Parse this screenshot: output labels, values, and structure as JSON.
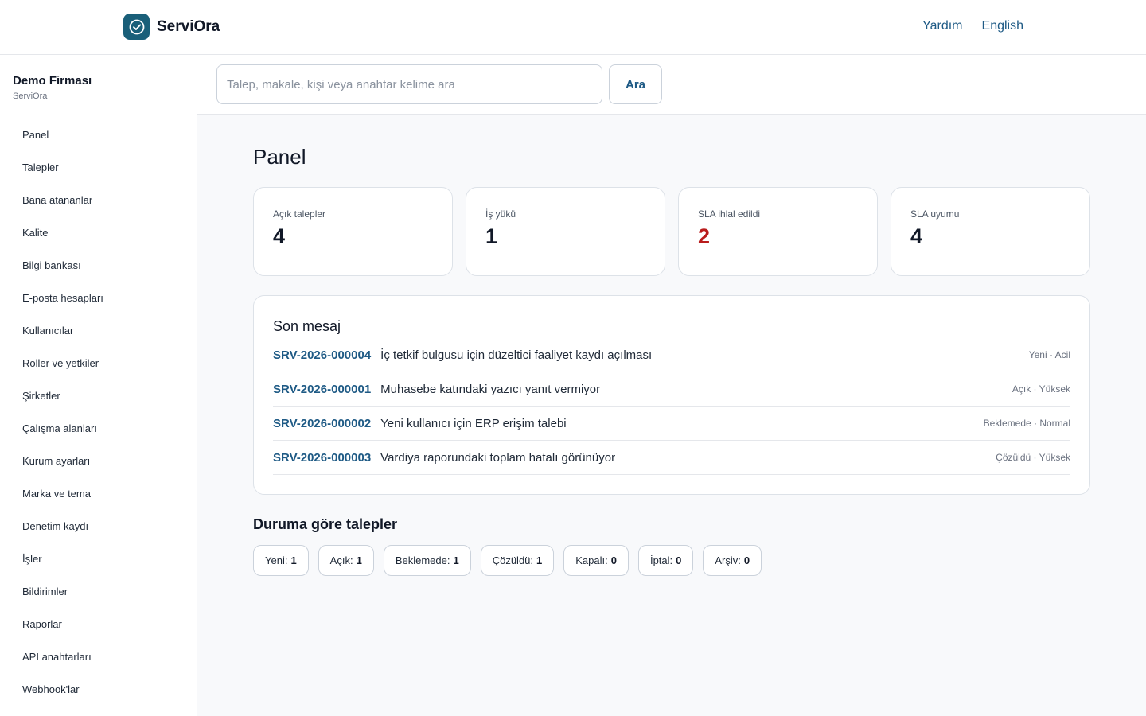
{
  "brand": {
    "name": "ServiOra"
  },
  "top_links": [
    {
      "label": "Yardım"
    },
    {
      "label": "English"
    }
  ],
  "org": {
    "name": "Demo Firması",
    "sub": "ServiOra"
  },
  "nav": [
    {
      "label": "Panel"
    },
    {
      "label": "Talepler"
    },
    {
      "label": "Bana atananlar"
    },
    {
      "label": "Kalite"
    },
    {
      "label": "Bilgi bankası"
    },
    {
      "label": "E-posta hesapları"
    },
    {
      "label": "Kullanıcılar"
    },
    {
      "label": "Roller ve yetkiler"
    },
    {
      "label": "Şirketler"
    },
    {
      "label": "Çalışma alanları"
    },
    {
      "label": "Kurum ayarları"
    },
    {
      "label": "Marka ve tema"
    },
    {
      "label": "Denetim kaydı"
    },
    {
      "label": "İşler"
    },
    {
      "label": "Bildirimler"
    },
    {
      "label": "Raporlar"
    },
    {
      "label": "API anahtarları"
    },
    {
      "label": "Webhook'lar"
    }
  ],
  "search": {
    "placeholder": "Talep, makale, kişi veya anahtar kelime ara",
    "value": "",
    "button": "Ara"
  },
  "page": {
    "title": "Panel"
  },
  "stats": [
    {
      "label": "Açık talepler",
      "value": "4"
    },
    {
      "label": "İş yükü",
      "value": "1"
    },
    {
      "label": "SLA ihlal edildi",
      "value": "2"
    },
    {
      "label": "SLA uyumu",
      "value": "4"
    }
  ],
  "messages": {
    "title": "Son mesaj",
    "rows": [
      {
        "code": "SRV-2026-000004",
        "subject": "İç tetkif bulgusu için düzeltici faaliyet kaydı açılması",
        "meta": "Yeni · Acil"
      },
      {
        "code": "SRV-2026-000001",
        "subject": "Muhasebe katındaki yazıcı yanıt vermiyor",
        "meta": "Açık · Yüksek"
      },
      {
        "code": "SRV-2026-000002",
        "subject": "Yeni kullanıcı için ERP erişim talebi",
        "meta": "Beklemede · Normal"
      },
      {
        "code": "SRV-2026-000003",
        "subject": "Vardiya raporundaki toplam hatalı görünüyor",
        "meta": "Çözüldü · Yüksek"
      }
    ]
  },
  "status": {
    "title": "Duruma göre talepler",
    "pills": [
      {
        "label": "Yeni:",
        "count": "1"
      },
      {
        "label": "Açık:",
        "count": "1"
      },
      {
        "label": "Beklemede:",
        "count": "1"
      },
      {
        "label": "Çözüldü:",
        "count": "1"
      },
      {
        "label": "Kapalı:",
        "count": "0"
      },
      {
        "label": "İptal:",
        "count": "0"
      },
      {
        "label": "Arşiv:",
        "count": "0"
      }
    ]
  },
  "colors": {
    "accent": "#1e5a85",
    "brand": "#1a5f79",
    "danger": "#b91c1c"
  },
  "icons": {
    "brand_logo": "check-circle-icon"
  }
}
